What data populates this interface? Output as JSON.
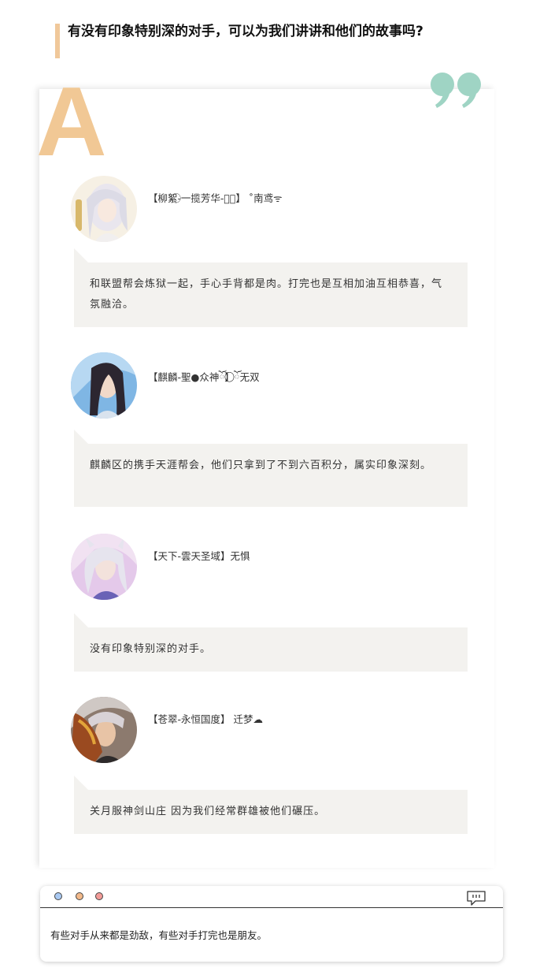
{
  "question": {
    "text": "有没有印象特别深的对手，可以为我们讲讲和他们的故事吗?"
  },
  "answer": {
    "letter": "A",
    "entries": [
      {
        "name": "【柳絮-⃝一揽芳华-ঞ⃝】 ˚南鸢ᯤ",
        "text": "和联盟帮会炼狱一起，手心手背都是肉。打完也是互相加油互相恭喜，气氛融洽。"
      },
      {
        "name": "【麒麟-聖●众神ོ】⃝⃝⃝ོ无双",
        "text": "麒麟区的携手天涯帮会，他们只拿到了不到六百积分，属实印象深刻。"
      },
      {
        "name": "【天下-雲天圣域】无惧",
        "text": "没有印象特别深的对手。"
      },
      {
        "name": "【苍翠-永恒国度】  迁梦☁",
        "text": "关月服神剑山庄  因为我们经常群雄被他们碾压。"
      }
    ]
  },
  "summary": {
    "text": "有些对手从来都是劲敌，有些对手打完也是朋友。",
    "icon": "chat-bubble-icon"
  },
  "colors": {
    "accent_orange": "#f0c89a",
    "quote_teal": "#9fd4c4",
    "bubble_bg": "#f3f2ef"
  }
}
